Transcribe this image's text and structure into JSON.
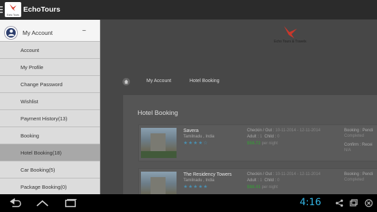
{
  "actionbar": {
    "title": "EchoTours",
    "logo_caption": "Echo Tours",
    "menu_icon": "hamburger-icon"
  },
  "content": {
    "logo_caption": "Echo Tours & Travels",
    "breadcrumb": {
      "home_icon": "home-icon",
      "items": [
        "My Account",
        "Hotel Booking"
      ]
    },
    "panel_title": "Hotel Booking",
    "bookings": [
      {
        "name": "Savera",
        "location": "Tamilnadu , India",
        "stars": "★★★★☆",
        "checkin_label": "Checkin / Out :",
        "checkin_value": "10-11-2014 - 12-11-2014",
        "adult_label": "Adult :",
        "adult_value": "1",
        "child_label": "Child :",
        "child_value": "0",
        "price": "$58.72",
        "price_unit": "per night",
        "booking_label": "Booking : Pendi",
        "booking_value": "Completed",
        "confirm_label": "Confirm : Recei",
        "confirm_value": "N/A"
      },
      {
        "name": "The Residency Towers",
        "location": "Tamilnadu , India",
        "stars": "★★★★★",
        "checkin_label": "Checkin / Out :",
        "checkin_value": "10-11-2014 - 12-11-2014",
        "adult_label": "Adult :",
        "adult_value": "1",
        "child_label": "Child :",
        "child_value": "0",
        "price": "$88.41",
        "price_unit": "per night",
        "booking_label": "Booking : Pendi",
        "booking_value": "Completed",
        "confirm_label": "",
        "confirm_value": ""
      }
    ]
  },
  "drawer": {
    "header": {
      "title": "My Account",
      "icon": "account-icon",
      "collapse_symbol": "−"
    },
    "items": [
      {
        "label": "Account"
      },
      {
        "label": "My Profile"
      },
      {
        "label": "Change Password"
      },
      {
        "label": "Wishlist"
      },
      {
        "label": "Payment History(13)"
      },
      {
        "label": "Booking"
      },
      {
        "label": "Hotel Booking(18)"
      },
      {
        "label": "Car Booking(5)"
      },
      {
        "label": "Package Booking(0)"
      }
    ],
    "active_index": 6
  },
  "system_bar": {
    "time": "4:16",
    "icons": [
      "back-icon",
      "home-icon",
      "recents-icon",
      "share-icon",
      "window-icon",
      "close-icon"
    ]
  },
  "colors": {
    "accent_brand": "#d83a2c",
    "clock_blue": "#33b5e5",
    "price_green": "#3e8f3e",
    "star_blue": "#4a8fb0"
  }
}
